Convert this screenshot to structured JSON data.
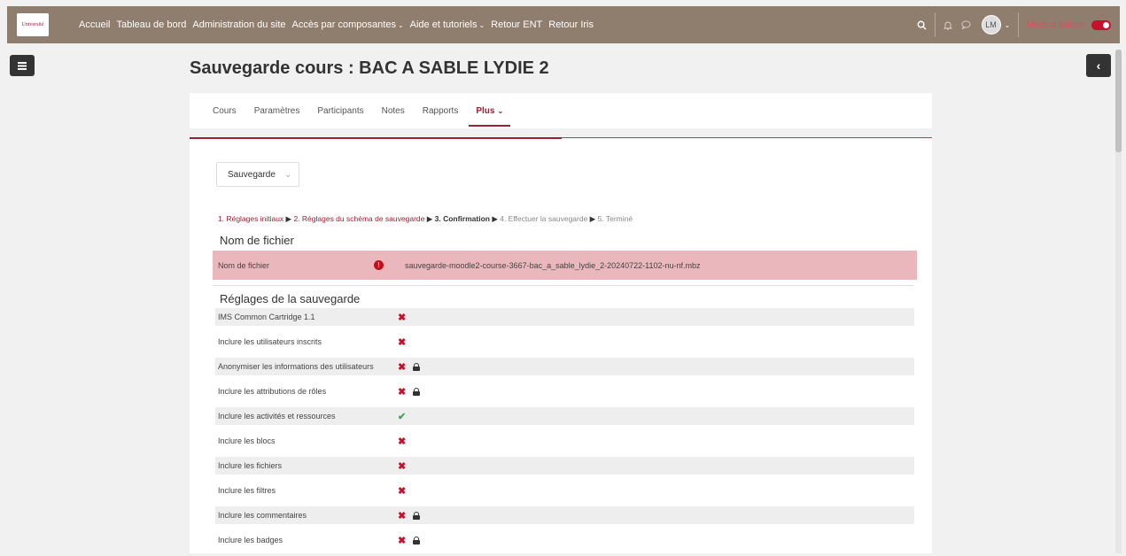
{
  "topbar": {
    "logo_text": "Université",
    "nav": [
      {
        "label": "Accueil",
        "dropdown": false
      },
      {
        "label": "Tableau de bord",
        "dropdown": false
      },
      {
        "label": "Administration du site",
        "dropdown": false
      },
      {
        "label": "Accès par composantes",
        "dropdown": true
      },
      {
        "label": "Aide et tutoriels",
        "dropdown": true
      },
      {
        "label": "Retour ENT",
        "dropdown": false
      },
      {
        "label": "Retour Iris",
        "dropdown": false
      }
    ],
    "avatar_initials": "LM",
    "edit_mode_label": "Mode d'édition",
    "edit_mode_on": true
  },
  "page_title": "Sauvegarde cours : BAC A SABLE LYDIE 2",
  "secondary_nav": [
    {
      "label": "Cours",
      "active": false
    },
    {
      "label": "Paramètres",
      "active": false
    },
    {
      "label": "Participants",
      "active": false
    },
    {
      "label": "Notes",
      "active": false
    },
    {
      "label": "Rapports",
      "active": false
    },
    {
      "label": "Plus",
      "active": true
    }
  ],
  "select_value": "Sauvegarde",
  "steps": [
    {
      "label": "1. Réglages initiaux",
      "state": "done"
    },
    {
      "label": "2. Réglages du schéma de sauvegarde",
      "state": "done"
    },
    {
      "label": "3. Confirmation",
      "state": "current"
    },
    {
      "label": "4. Effectuer la sauvegarde",
      "state": "todo"
    },
    {
      "label": "5. Terminé",
      "state": "todo"
    }
  ],
  "filename_section": {
    "legend": "Nom de fichier",
    "label": "Nom de fichier",
    "value": "sauvegarde-moodle2-course-3667-bac_a_sable_lydie_2-20240722-1102-nu-nf.mbz"
  },
  "settings_section": {
    "legend": "Réglages de la sauvegarde",
    "rows": [
      {
        "label": "IMS Common Cartridge 1.1",
        "enabled": false,
        "locked": false
      },
      {
        "label": "Inclure les utilisateurs inscrits",
        "enabled": false,
        "locked": false
      },
      {
        "label": "Anonymiser les informations des utilisateurs",
        "enabled": false,
        "locked": true
      },
      {
        "label": "Inclure les attributions de rôles",
        "enabled": false,
        "locked": true
      },
      {
        "label": "Inclure les activités et ressources",
        "enabled": true,
        "locked": false
      },
      {
        "label": "Inclure les blocs",
        "enabled": false,
        "locked": false
      },
      {
        "label": "Inclure les fichiers",
        "enabled": false,
        "locked": false
      },
      {
        "label": "Inclure les filtres",
        "enabled": false,
        "locked": false
      },
      {
        "label": "Inclure les commentaires",
        "enabled": false,
        "locked": true
      },
      {
        "label": "Inclure les badges",
        "enabled": false,
        "locked": true
      }
    ]
  },
  "colors": {
    "brand": "#a11d33",
    "navbar": "#8f7d6d",
    "error_bg": "#eab8bc",
    "check": "#3aa655"
  }
}
